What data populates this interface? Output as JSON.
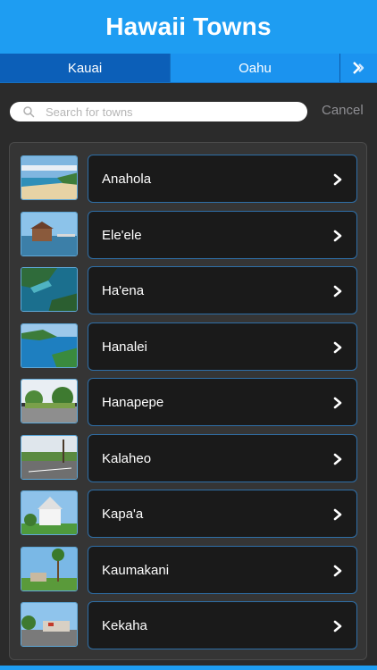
{
  "header": {
    "title": "Hawaii Towns"
  },
  "tabs": [
    {
      "label": "Kauai",
      "active": true
    },
    {
      "label": "Oahu",
      "active": false
    }
  ],
  "search": {
    "placeholder": "Search for towns",
    "cancel_label": "Cancel"
  },
  "towns": [
    {
      "name": "Anahola"
    },
    {
      "name": "Ele'ele"
    },
    {
      "name": "Ha'ena"
    },
    {
      "name": "Hanalei"
    },
    {
      "name": "Hanapepe"
    },
    {
      "name": "Kalaheo"
    },
    {
      "name": "Kapa'a"
    },
    {
      "name": "Kaumakani"
    },
    {
      "name": "Kekaha"
    }
  ],
  "colors": {
    "accent": "#1e9df2",
    "tab_active": "#0c5fb8",
    "cell_border": "#2f6fa8"
  }
}
